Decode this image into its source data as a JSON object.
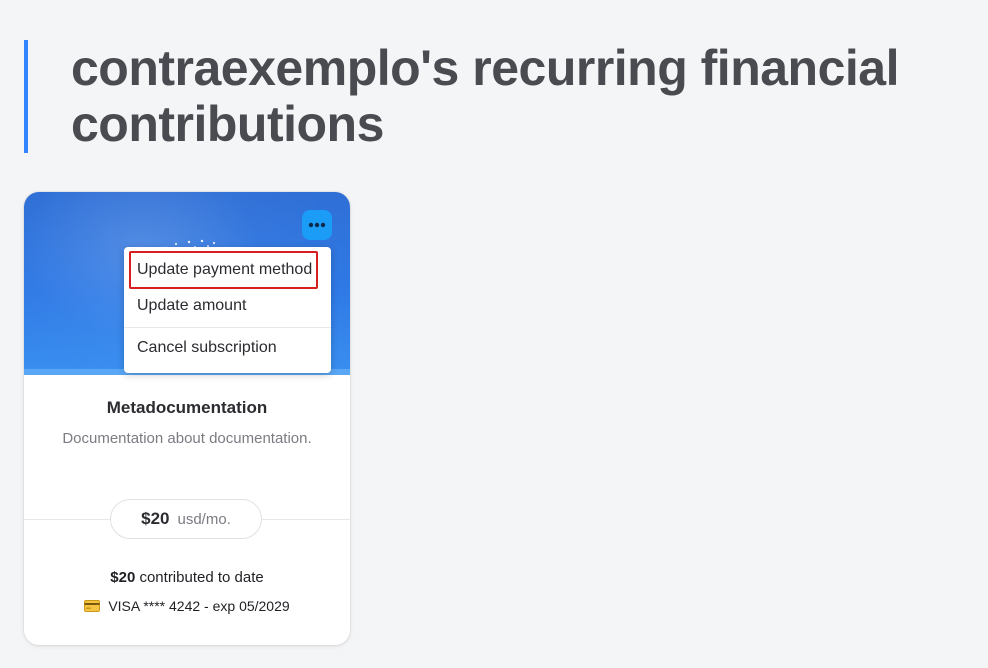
{
  "page": {
    "title": "contraexemplo's recurring financial contributions"
  },
  "card": {
    "collective_name": "Metadocumentation",
    "collective_description": "Documentation about documentation.",
    "amount": "$20",
    "amount_unit": "usd/mo.",
    "contributed_amount": "$20",
    "contributed_suffix": " contributed to date",
    "payment_method": "VISA **** 4242 - exp 05/2029",
    "icons": {
      "more": "more-horizontal-icon",
      "card": "credit-card-icon"
    },
    "colors": {
      "banner": "#2f7ae6",
      "more_button": "#1a9cf7",
      "title_accent": "#3385ff"
    }
  },
  "menu": {
    "items": [
      {
        "label": "Update payment method",
        "highlighted": true
      },
      {
        "label": "Update amount",
        "highlighted": false
      },
      {
        "label": "Cancel subscription",
        "highlighted": false
      }
    ],
    "highlight_color": "#d62020"
  }
}
